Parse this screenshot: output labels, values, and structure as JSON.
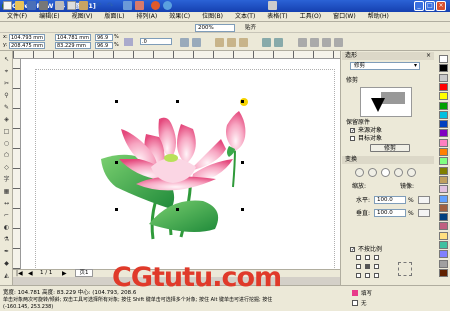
{
  "window": {
    "title": "CorelDRAW X4 - [图形1]"
  },
  "menu": [
    "文件(F)",
    "编辑(E)",
    "视图(V)",
    "版面(L)",
    "排列(A)",
    "效果(C)",
    "位图(B)",
    "文本(T)",
    "表格(T)",
    "工具(O)",
    "窗口(W)",
    "帮助(H)"
  ],
  "toolbar": {
    "zoom": "200%",
    "snap_label": "贴齐"
  },
  "propbar": {
    "x": "104.793 mm",
    "y": "208.475 mm",
    "w": "104.781 mm",
    "h": "83.229 mm",
    "scale_x": "96.9",
    "scale_y": "96.9",
    "percent": "%",
    "angle": ".0"
  },
  "canvas": {
    "page_nav": "1 / 1",
    "page_tab": "页1"
  },
  "docker": {
    "shaping_title": "造形",
    "mode": "修剪",
    "section_label": "修剪",
    "keep_original": "保留原件",
    "source_object": "来源对象",
    "target_object": "目标对象",
    "apply_button": "修剪",
    "transform_title": "变换",
    "scale_label": "缩放:",
    "mirror_label": "镜像:",
    "h_label": "水平:",
    "h_value": "100.0",
    "v_label": "垂直:",
    "v_value": "100.0",
    "proportional": "不按比例",
    "percent": "%"
  },
  "status": {
    "line1": "宽度: 104.781  高度: 83.229  中心: (104.793, 208.6",
    "line2": "单击对象两次可旋转/倾斜; 双击工具可选择所有对象; 按住 Shift 键单击可选择多个对象; 按住 Alt 键单击可进行挖掘; 按住",
    "coords": "(-160.145, 253.238)",
    "fill_label": "填写",
    "outline_label": "无"
  },
  "watermark": "CGtutu.com",
  "colors": {
    "accent": "#2b62d6",
    "watermark": "#e03a2a",
    "lotus_pink": "#f07aa0",
    "leaf_green": "#3aa84a"
  },
  "palette": [
    "#ffffff",
    "#000000",
    "#c8c8c8",
    "#ff0000",
    "#ffff00",
    "#00a000",
    "#00c0e0",
    "#0040c0",
    "#8000c0",
    "#ff80c0",
    "#ff8000",
    "#80ff80",
    "#808000",
    "#c0a060",
    "#e0c0e0",
    "#60a0ff",
    "#a06040",
    "#004080",
    "#c06080",
    "#ffe080",
    "#40c0a0",
    "#8080ff",
    "#a0a0a0",
    "#602000"
  ]
}
